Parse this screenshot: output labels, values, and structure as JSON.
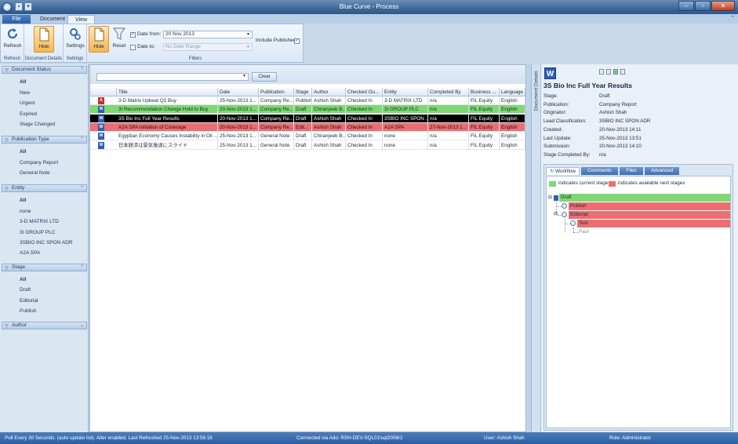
{
  "window": {
    "title": "Blue Curve - Process"
  },
  "ribbon_tabs": [
    {
      "label": "File"
    },
    {
      "label": "Document"
    },
    {
      "label": "View"
    }
  ],
  "ribbon": {
    "refresh_label": "Refresh",
    "refresh_group": "Refresh",
    "hide_details_label": "Hide",
    "details_group": "Document Details",
    "settings_label": "Settings",
    "settings_group": "Settings",
    "hide_filter_label": "Hide",
    "reset_label": "Reset",
    "date_from_label": "Date from:",
    "date_from_checked": true,
    "date_from_value": "20 Nov 2013",
    "date_to_label": "Date to:",
    "date_to_checked": false,
    "date_to_placeholder": "No Date Range",
    "include_published_label": "Include Published",
    "include_published_checked": true,
    "filters_group": "Filters"
  },
  "left_panel": {
    "sections": [
      {
        "title": "Document Status",
        "items": [
          "All",
          "New",
          "Urgent",
          "Expired",
          "Stage Changed"
        ]
      },
      {
        "title": "Publication Type",
        "items": [
          "All",
          "Company Report",
          "General Note"
        ]
      },
      {
        "title": "Entity",
        "items": [
          "All",
          "none",
          "3-D MATRIX LTD",
          "3I GROUP PLC",
          "3SBIO INC SPON ADR",
          "A2A SPA"
        ]
      },
      {
        "title": "Stage",
        "items": [
          "All",
          "Draft",
          "Editorial",
          "Publish"
        ]
      },
      {
        "title": "Author",
        "items": []
      }
    ]
  },
  "grid_toolbar": {
    "clear_label": "Clear",
    "filter_value": ""
  },
  "grid": {
    "columns": [
      "Title",
      "Date",
      "Publication",
      "Stage",
      "Author",
      "Checked Ou...",
      "Entity",
      "Completed By",
      "Business ...",
      "Language"
    ],
    "rows": [
      {
        "icon": "pdf",
        "style": "normal",
        "cells": [
          "3-D Matrix Upbeat Q1 Buy",
          "25-Nov-2013 1...",
          "Company Re...",
          "Publish",
          "Ashish Shah",
          "Checked In",
          "3-D MATRIX LTD",
          "n/a",
          "FIL Equity",
          "English"
        ]
      },
      {
        "icon": "word",
        "style": "green",
        "cells": [
          "3I Recommendation Change Hold to Buy",
          "20-Nov-2013 1...",
          "Company Re...",
          "Draft",
          "Chiranjeeb B...",
          "Checked In",
          "3I GROUP PLC",
          "n/a",
          "FIL Equity",
          "English"
        ]
      },
      {
        "icon": "word",
        "style": "selected",
        "cells": [
          "3S Bio Inc Full Year Results",
          "20-Nov-2013 1...",
          "Company Re...",
          "Draft",
          "Ashish Shah",
          "Checked In",
          "3SBIO INC SPON ...",
          "n/a",
          "FIL Equity",
          "English"
        ]
      },
      {
        "icon": "word",
        "style": "red",
        "cells": [
          "A2A SPA Initiation of Coverage",
          "20-Nov-2013 1...",
          "Company Re...",
          "Edit...",
          "Ashish Shah",
          "Checked In",
          "A2A SPA",
          "27-Nov-2013 1...",
          "FIL Equity",
          "English"
        ]
      },
      {
        "icon": "word",
        "style": "normal",
        "cells": [
          "Egyptian Economy Causes Instability in Oil ...",
          "25-Nov-2013 1...",
          "General Note",
          "Draft",
          "Chiranjeeb B...",
          "Checked In",
          "none",
          "n/a",
          "FIL Equity",
          "English"
        ]
      },
      {
        "icon": "word",
        "style": "normal",
        "cells": [
          "日本経済は景気後退にスライド",
          "25-Nov-2013 1...",
          "General Note",
          "Draft",
          "Ashish Shah",
          "Checked In",
          "none",
          "n/a",
          "FIL Equity",
          "English"
        ]
      }
    ]
  },
  "details": {
    "vertical_tab": "Document Details",
    "title": "3S Bio Inc Full Year Results",
    "properties": [
      {
        "label": "Stage:",
        "value": "Draft"
      },
      {
        "label": "Publication:",
        "value": "Company Report"
      },
      {
        "label": "Originator:",
        "value": "Ashish Shah"
      },
      {
        "label": "Lead Classification:",
        "value": "3SBIO INC SPON ADR"
      },
      {
        "label": "Created:",
        "value": "20-Nov-2013 14:11"
      },
      {
        "label": "Last Update:",
        "value": "25-Nov-2013 13:51"
      },
      {
        "label": "Submission:",
        "value": "20-Nov-2013 14:10"
      },
      {
        "label": "Stage Completed By:",
        "value": "n/a"
      }
    ],
    "tabs": [
      "Workflow",
      "Comments",
      "Files",
      "Advanced"
    ],
    "legend_current": "indicates current stage",
    "legend_next": "indicates available next stages",
    "workflow": [
      {
        "label": "Draft",
        "style": "green"
      },
      {
        "label": "Publish",
        "style": "red"
      },
      {
        "label": "Editorial",
        "style": "red"
      },
      {
        "label": "Test",
        "style": "red"
      },
      {
        "label": "Paul",
        "style": "plain"
      }
    ]
  },
  "status": {
    "poll": "Poll Every 30 Seconds. (auto update list). Alter enabled. Last Refreshed 25-Nov-2013 13:58:18",
    "connection": "Connected via Ado: RSH-DEV-SQL01\\sql2008r2",
    "user": "User: Ashish Shah",
    "role": "Role: Administrator"
  },
  "colors": {
    "current_stage": "#7fd873",
    "next_stage": "#ec6e72",
    "selected_row": "#000000",
    "accent": "#2c5fa2"
  }
}
